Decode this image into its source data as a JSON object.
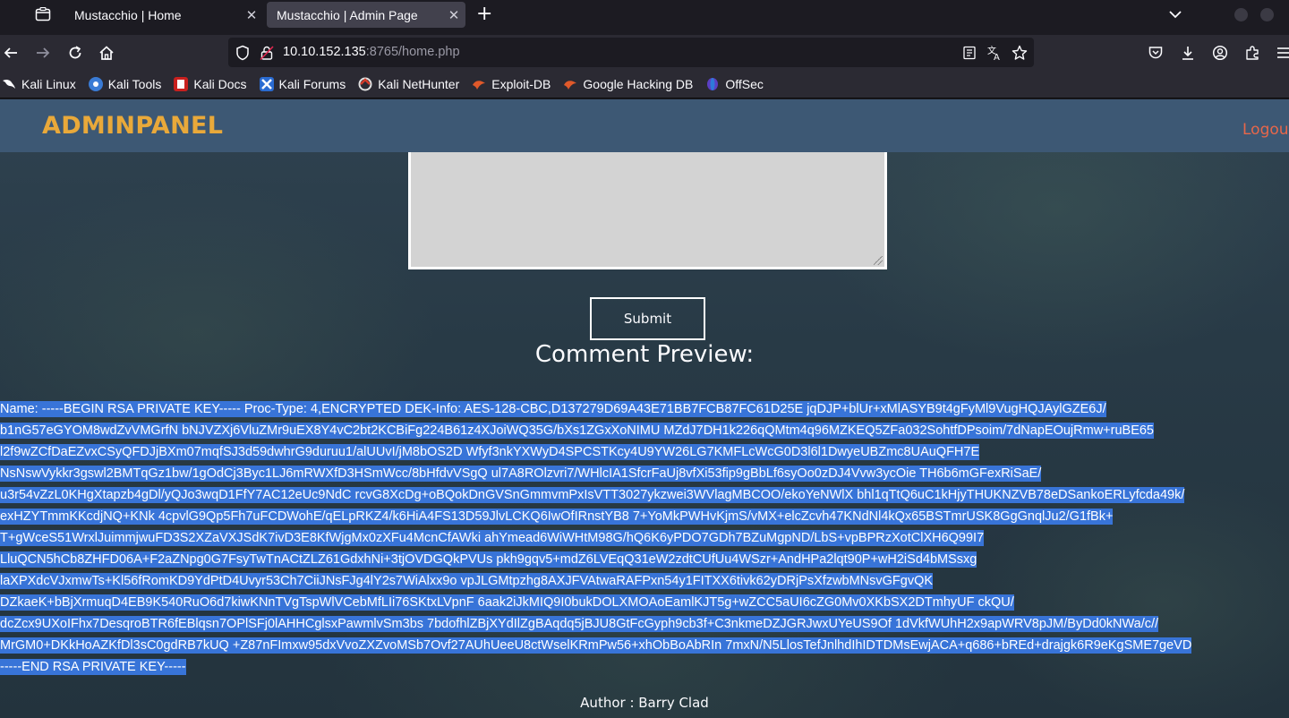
{
  "browser": {
    "tabs": [
      {
        "title": "Mustacchio | Home",
        "close": "✕"
      },
      {
        "title": "Mustacchio | Admin Page",
        "close": "✕"
      }
    ],
    "new_tab": "+",
    "url_host": "10.10.152.135",
    "url_path": ":8765/home.php",
    "bookmarks": [
      {
        "label": "Kali Linux",
        "icon": "kali-dragon-icon"
      },
      {
        "label": "Kali Tools",
        "icon": "kali-tools-icon"
      },
      {
        "label": "Kali Docs",
        "icon": "kali-docs-icon"
      },
      {
        "label": "Kali Forums",
        "icon": "kali-forums-icon"
      },
      {
        "label": "Kali NetHunter",
        "icon": "nethunter-icon"
      },
      {
        "label": "Exploit-DB",
        "icon": "exploit-db-icon"
      },
      {
        "label": "Google Hacking DB",
        "icon": "ghdb-icon"
      },
      {
        "label": "OffSec",
        "icon": "offsec-icon"
      }
    ]
  },
  "header": {
    "brand": "ADMINPANEL",
    "logout": "Logout"
  },
  "form": {
    "submit_label": "Submit"
  },
  "preview": {
    "title": "Comment Preview:",
    "lines": [
      "Name: -----BEGIN RSA PRIVATE KEY----- Proc-Type: 4,ENCRYPTED DEK-Info: AES-128-CBC,D137279D69A43E71BB7FCB87FC61D25E jqDJP+blUr+xMlASYB9t4gFyMl9VugHQJAylGZE6J/",
      "b1nG57eGYOM8wdZvVMGrfN bNJVZXj6VluZMr9uEX8Y4vC2bt2KCBiFg224B61z4XJoiWQ35G/bXs1ZGxXoNIMU MZdJ7DH1k226qQMtm4q96MZKEQ5ZFa032SohtfDPsoim/7dNapEOujRmw+ruBE65",
      "l2f9wZCfDaEZvxCSyQFDJjBXm07mqfSJ3d59dwhrG9duruu1/alUUvI/jM8bOS2D Wfyf3nkYXWyD4SPCSTKcy4U9YW26LG7KMFLcWcG0D3l6l1DwyeUBZmc8UAuQFH7E",
      "NsNswVykkr3gswl2BMTqGz1bw/1gOdCj3Byc1LJ6mRWXfD3HSmWcc/8bHfdvVSgQ ul7A8ROlzvri7/WHlcIA1SfcrFaUj8vfXi53fip9gBbLf6syOo0zDJ4Vvw3ycOie TH6b6mGFexRiSaE/",
      "u3r54vZzL0KHgXtapzb4gDl/yQJo3wqD1FfY7AC12eUc9NdC rcvG8XcDg+oBQokDnGVSnGmmvmPxIsVTT3027ykzwei3WVlagMBCOO/ekoYeNWlX bhl1qTtQ6uC1kHjyTHUKNZVB78eDSankoERLyfcda49k/",
      "exHZYTmmKKcdjNQ+KNk 4cpvlG9Qp5Fh7uFCDWohE/qELpRKZ4/k6HiA4FS13D59JlvLCKQ6IwOfIRnstYB8 7+YoMkPWHvKjmS/vMX+elcZcvh47KNdNl4kQx65BSTmrUSK8GgGnqlJu2/G1fBk+",
      "T+gWceS51WrxlJuimmjwuFD3S2XZaVXJSdK7ivD3E8KfWjgMx0zXFu4McnCfAWki ahYmead6WiWHtM98G/hQ6K6yPDO7GDh7BZuMgpND/LbS+vpBPRzXotClXH6Q99I7",
      "LluQCN5hCb8ZHFD06A+F2aZNpg0G7FsyTwTnACtZLZ61GdxhNi+3tjOVDGQkPVUs pkh9gqv5+mdZ6LVEqQ31eW2zdtCUfUu4WSzr+AndHPa2lqt90P+wH2iSd4bMSsxg",
      "laXPXdcVJxmwTs+Kl56fRomKD9YdPtD4Uvyr53Ch7CiiJNsFJg4lY2s7WiAlxx9o vpJLGMtpzhg8AXJFVAtwaRAFPxn54y1FITXX6tivk62yDRjPsXfzwbMNsvGFgvQK",
      "DZkaeK+bBjXrmuqD4EB9K540RuO6d7kiwKNnTVgTspWlVCebMfLIi76SKtxLVpnF 6aak2iJkMIQ9I0bukDOLXMOAoEamlKJT5g+wZCC5aUI6cZG0Mv0XKbSX2DTmhyUF ckQU/",
      "dcZcx9UXoIFhx7DesqroBTR6fEBlqsn7OPlSFj0lAHHCglsxPawmlvSm3bs 7bdofhlZBjXYdIlZgBAqdq5jBJU8GtFcGyph9cb3f+C3nkmeDZJGRJwxUYeUS9Of 1dVkfWUhH2x9apWRV8pJM/ByDd0kNWa/c//",
      "MrGM0+DKkHoAZKfDl3sC0gdRB7kUQ +Z87nFImxw95dxVvoZXZvoMSb7Ovf27AUhUeeU8ctWselKRmPw56+xhObBoAbRIn 7mxN/N5LlosTefJnlhdIhIDTDMsEwjACA+q686+bREd+drajgk6R9eKgSME7geVD",
      "-----END RSA PRIVATE KEY-----"
    ],
    "author": "Author : Barry Clad"
  }
}
